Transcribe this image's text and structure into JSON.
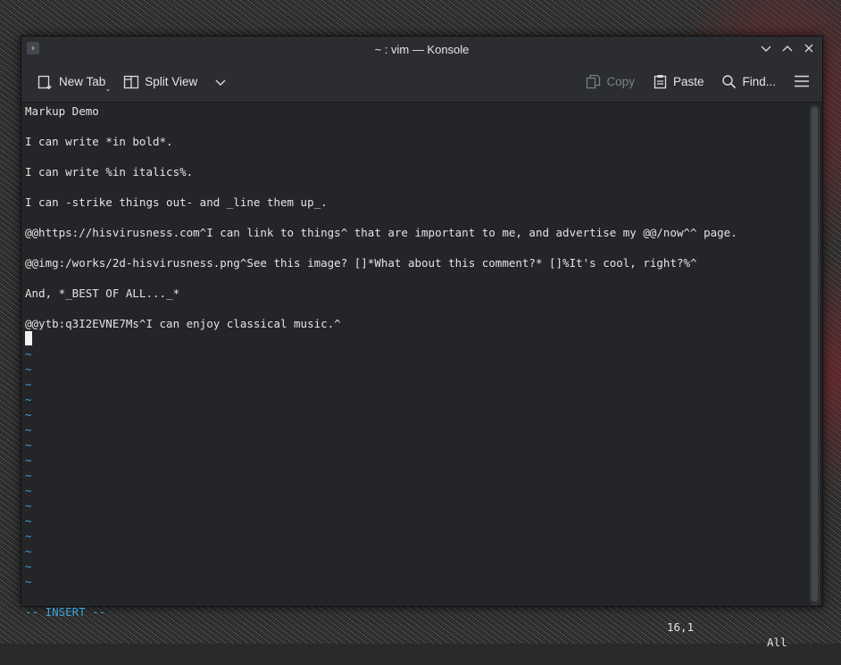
{
  "window": {
    "title": "~ : vim — Konsole",
    "app_icon": "konsole-icon",
    "controls": [
      "minimize",
      "maximize",
      "close"
    ]
  },
  "toolbar": {
    "new_tab": "New Tab",
    "split_view": "Split View",
    "copy": "Copy",
    "paste": "Paste",
    "find": "Find..."
  },
  "editor": {
    "lines": [
      "Markup Demo",
      "",
      "I can write *in bold*.",
      "",
      "I can write %in italics%.",
      "",
      "I can -strike things out- and _line them up_.",
      "",
      "@@https://hisvirusness.com^I can link to things^ that are important to me, and advertise my @@/now^^ page.",
      "",
      "@@img:/works/2d-hisvirusness.png^See this image? []*What about this comment?* []%It's cool, right?%^",
      "",
      "And, *_BEST OF ALL..._*",
      "",
      "@@ytb:q3I2EVNE7Ms^I can enjoy classical music.^"
    ],
    "empty_line_marker": "~",
    "empty_line_count": 16
  },
  "status": {
    "mode": "-- INSERT --",
    "position": "16,1",
    "scope": "All"
  },
  "colors": {
    "background": "#232528",
    "text": "#e4e4e4",
    "tilde": "#3aa1d9",
    "mode": "#3aa1d9"
  }
}
